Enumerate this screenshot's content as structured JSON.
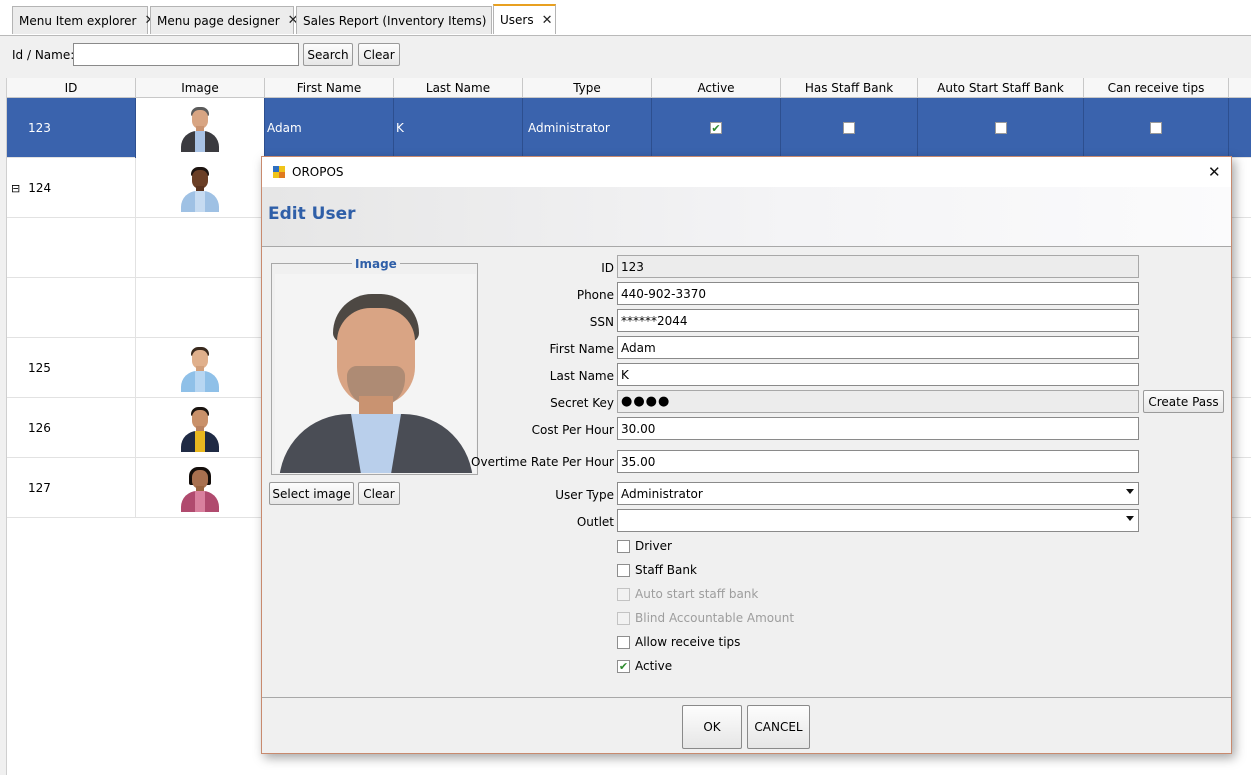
{
  "tabs": [
    {
      "label": "Menu Item explorer",
      "active": false
    },
    {
      "label": "Menu page designer",
      "active": false
    },
    {
      "label": "Sales Report (Inventory Items)",
      "active": false
    },
    {
      "label": "Users",
      "active": true
    }
  ],
  "search": {
    "label": "Id / Name:",
    "value": "",
    "search_button": "Search",
    "clear_button": "Clear"
  },
  "table": {
    "columns": [
      "ID",
      "Image",
      "First Name",
      "Last Name",
      "Type",
      "Active",
      "Has Staff Bank",
      "Auto Start Staff Bank",
      "Can receive tips"
    ],
    "rows": [
      {
        "id": "123",
        "first_name": "Adam",
        "last_name": "K",
        "type": "Administrator",
        "active": true,
        "has_staff_bank": false,
        "auto_start_staff_bank": false,
        "can_receive_tips": false,
        "selected": true,
        "expander": "",
        "avatar": "man-grey-hair"
      },
      {
        "id": "124",
        "first_name": "",
        "last_name": "",
        "type": "",
        "selected": false,
        "expander": "⊟",
        "avatar": "man-dark-skin"
      },
      {
        "id": "",
        "selected": false,
        "expander": "",
        "avatar": ""
      },
      {
        "id": "",
        "selected": false,
        "expander": "",
        "avatar": ""
      },
      {
        "id": "125",
        "selected": false,
        "expander": "",
        "avatar": "man-casual"
      },
      {
        "id": "126",
        "selected": false,
        "expander": "",
        "avatar": "woman-blazer"
      },
      {
        "id": "127",
        "selected": false,
        "expander": "",
        "avatar": "woman-curly"
      }
    ]
  },
  "dialog": {
    "app_title": "OROPOS",
    "header": "Edit User",
    "image_legend": "Image",
    "select_image_button": "Select image",
    "clear_image_button": "Clear",
    "fields": {
      "id": {
        "label": "ID",
        "value": "123"
      },
      "phone": {
        "label": "Phone",
        "value": "440-902-3370"
      },
      "ssn": {
        "label": "SSN",
        "value": "******2044"
      },
      "first_name": {
        "label": "First Name",
        "value": "Adam"
      },
      "last_name": {
        "label": "Last Name",
        "value": "K"
      },
      "secret_key": {
        "label": "Secret Key",
        "value": "●●●●"
      },
      "cost_per_hour": {
        "label": "Cost Per Hour",
        "value": "30.00"
      },
      "overtime_rate": {
        "label": "Overtime Rate Per Hour",
        "value": "35.00"
      },
      "user_type": {
        "label": "User Type",
        "value": "Administrator"
      },
      "outlet": {
        "label": "Outlet",
        "value": ""
      }
    },
    "create_pass_button": "Create Pass",
    "checkboxes": [
      {
        "label": "Driver",
        "checked": false,
        "enabled": true
      },
      {
        "label": "Staff Bank",
        "checked": false,
        "enabled": true
      },
      {
        "label": "Auto start staff bank",
        "checked": false,
        "enabled": false
      },
      {
        "label": "Blind Accountable Amount",
        "checked": false,
        "enabled": false
      },
      {
        "label": "Allow receive tips",
        "checked": false,
        "enabled": true
      },
      {
        "label": "Active",
        "checked": true,
        "enabled": true
      }
    ],
    "ok_button": "OK",
    "cancel_button": "CANCEL",
    "close_glyph": "✕"
  },
  "glyphs": {
    "tab_close": "✕",
    "check": "✔"
  },
  "colors": {
    "selection_blue": "#3a63ad",
    "header_blue": "#2f5fa8",
    "active_tab_accent": "#e8a020",
    "check_green": "#2e8b2e"
  }
}
